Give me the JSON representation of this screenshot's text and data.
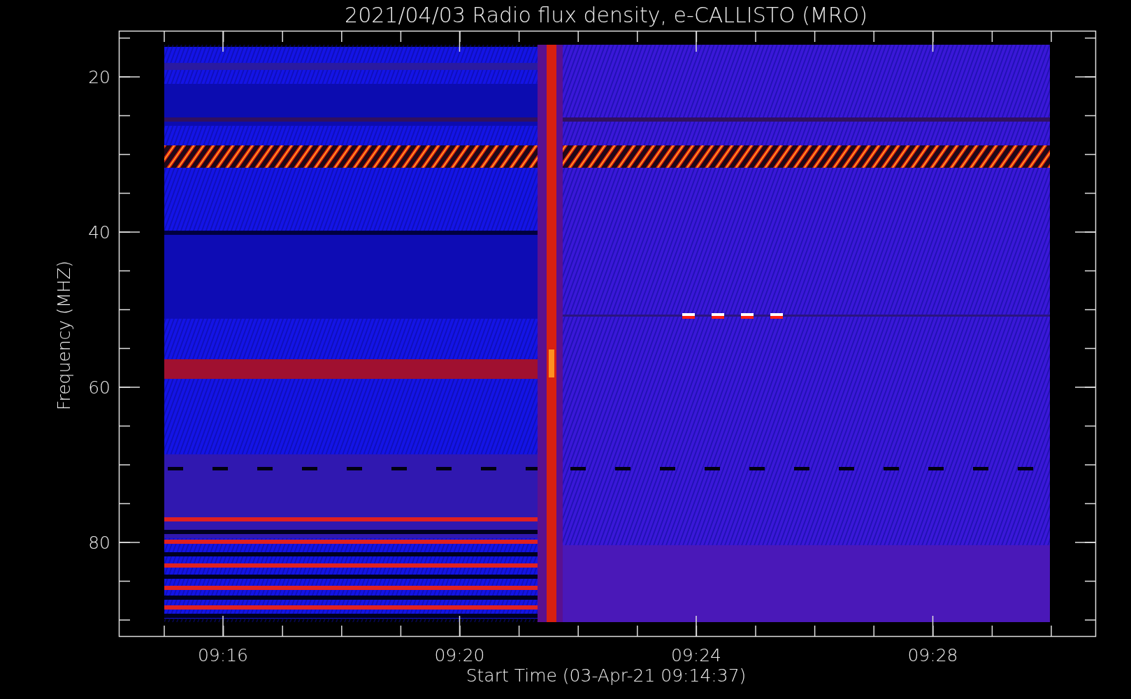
{
  "title": "2021/04/03  Radio flux density, e-CALLISTO (MRO)",
  "y_axis": {
    "label": "Frequency (MHZ)",
    "ticks": [
      "20",
      "40",
      "60",
      "80"
    ]
  },
  "x_axis": {
    "label": "Start Time (03-Apr-21 09:14:37)",
    "ticks": [
      "09:16",
      "09:20",
      "09:24",
      "09:28"
    ]
  }
}
